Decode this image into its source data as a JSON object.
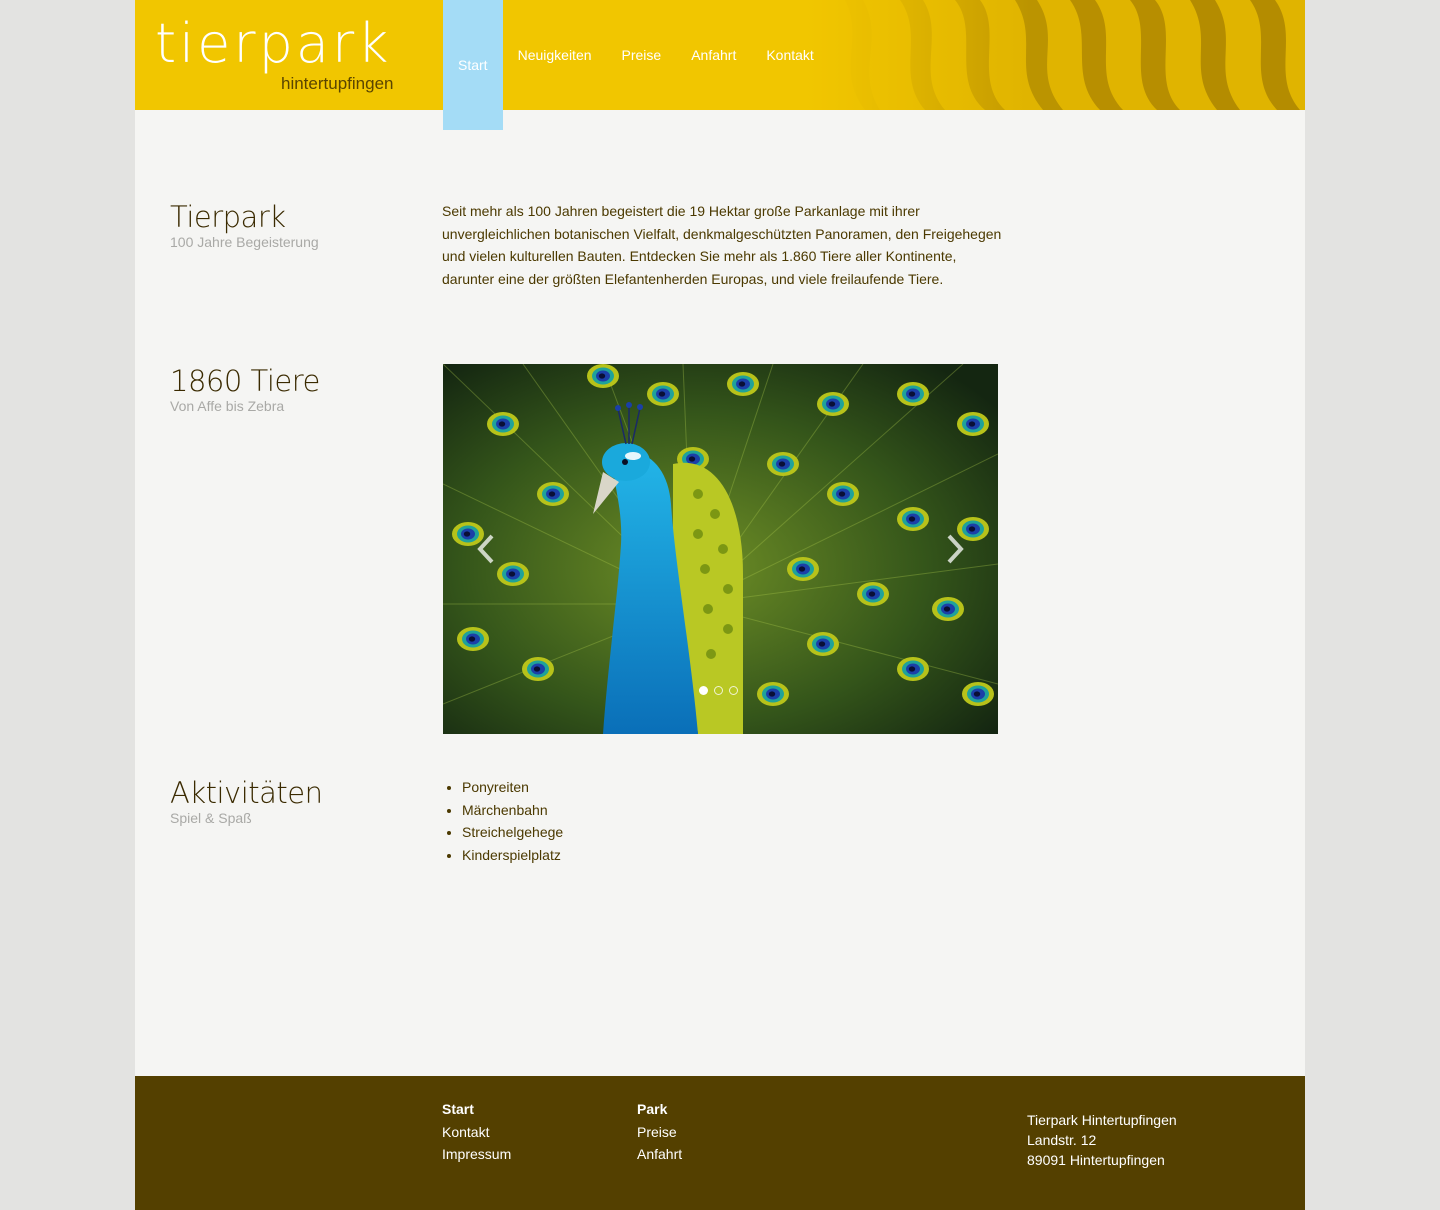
{
  "header": {
    "logo_title": "tierpark",
    "logo_subtitle": "hintertupfingen",
    "nav": [
      "Start",
      "Neuigkeiten",
      "Preise",
      "Anfahrt",
      "Kontakt"
    ],
    "active_nav": "Start"
  },
  "sections": {
    "tierpark": {
      "title": "Tierpark",
      "subtitle": "100 Jahre Begeisterung",
      "text": "Seit mehr als 100 Jahren begeistert die 19 Hektar große Parkanlage mit ihrer unvergleichlichen botanischen Vielfalt, denkmalgeschützten Panoramen, den Freigehegen und vielen kulturellen Bauten. Entdecken Sie mehr als 1.860 Tiere aller Kontinente, darunter eine der größten Elefantenherden Europas, und viele freilaufende Tiere."
    },
    "tiere": {
      "title": "1860 Tiere",
      "subtitle": "Von Affe bis Zebra",
      "slider": {
        "slide_count": 3,
        "active_slide": 1,
        "image_subject": "peacock"
      }
    },
    "aktivitaeten": {
      "title": "Aktivitäten",
      "subtitle": "Spiel & Spaß",
      "items": [
        "Ponyreiten",
        "Märchenbahn",
        "Streichelgehege",
        "Kinderspielplatz"
      ]
    }
  },
  "footer": {
    "col1": {
      "heading": "Start",
      "links": [
        "Kontakt",
        "Impressum"
      ]
    },
    "col2": {
      "heading": "Park",
      "links": [
        "Preise",
        "Anfahrt"
      ]
    },
    "address": [
      "Tierpark Hintertupfingen",
      "Landstr. 12",
      "89091 Hintertupfingen"
    ]
  },
  "colors": {
    "header_yellow": "#f1c600",
    "nav_active": "#a4dcf6",
    "footer_brown": "#544000",
    "text_brown": "#4b3900"
  },
  "icons": {
    "prev": "chevron-left-icon",
    "next": "chevron-right-icon"
  }
}
